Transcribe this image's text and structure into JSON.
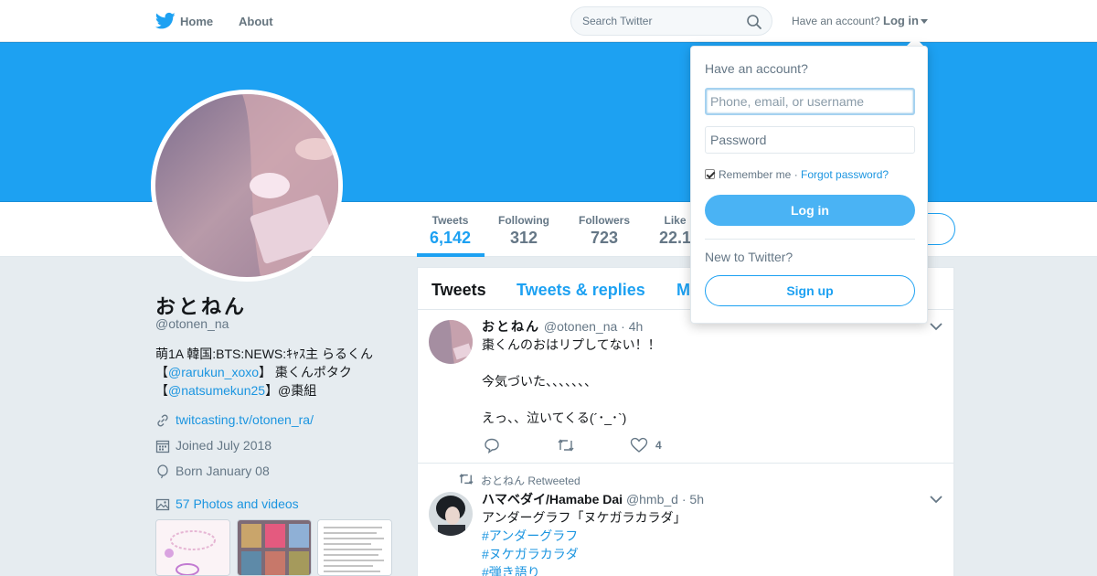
{
  "nav": {
    "home_label": "Home",
    "about_label": "About",
    "search_placeholder": "Search Twitter",
    "have_account": "Have an account?",
    "login_label": "Log in"
  },
  "profile": {
    "name": "おとねん",
    "handle": "@otonen_na",
    "bio_line1": "萌1A 韓国:BTS:NEWS:ｷｬｽ主 らるくん",
    "bio_line2_prefix": "【",
    "bio_line2_link": "@rarukun_xoxo",
    "bio_line2_suffix": "】 棗くんポタク",
    "bio_line3_prefix": "【",
    "bio_line3_link": "@natsumekun25",
    "bio_line3_suffix": "】@棗組",
    "website": "twitcasting.tv/otonen_ra/",
    "joined": "Joined July 2018",
    "born": "Born January 08",
    "photos": "57 Photos and videos"
  },
  "stats": [
    {
      "label": "Tweets",
      "value": "6,142"
    },
    {
      "label": "Following",
      "value": "312"
    },
    {
      "label": "Followers",
      "value": "723"
    },
    {
      "label": "Like",
      "value": "22.1"
    }
  ],
  "timeline": {
    "tabs": [
      "Tweets",
      "Tweets & replies",
      "M"
    ],
    "tweets": [
      {
        "author": "おとねん",
        "handle": "@otonen_na",
        "time": "· 4h",
        "text": "棗くんのおはリプしてない！！\n\n今気づいた、、、、、、、\n\nえっ、、泣いてくる(´･_･`)",
        "likes": "4"
      },
      {
        "retweeted_by": "おとねん Retweeted",
        "author": "ハマベダイ/Hamabe Dai",
        "handle": "@hmb_d",
        "time": "· 5h",
        "text": "アンダーグラフ「ヌケガラカラダ」",
        "hashtags": [
          "#アンダーグラフ",
          "#ヌケガラカラダ",
          "#弾き語り"
        ]
      }
    ]
  },
  "login_dropdown": {
    "title": "Have an account?",
    "username_placeholder": "Phone, email, or username",
    "password_placeholder": "Password",
    "remember_me": "Remember me ·",
    "forgot_password": "Forgot password?",
    "login_button": "Log in",
    "new_to_twitter": "New to Twitter?",
    "signup_button": "Sign up"
  },
  "colors": {
    "brand": "#1da1f2",
    "link": "#1b95e0",
    "background": "#e6ecf0"
  }
}
